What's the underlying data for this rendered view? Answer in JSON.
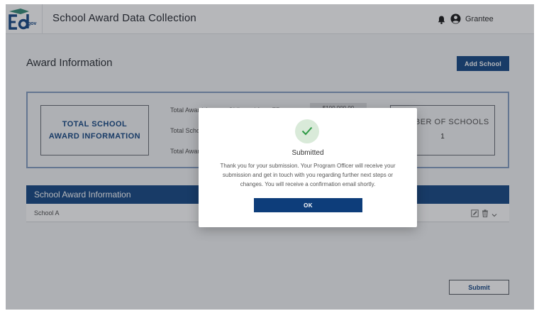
{
  "header": {
    "logo_text": ".gov",
    "title": "School Award Data Collection",
    "user_label": "Grantee",
    "icons": {
      "notifications": "bell-icon",
      "account": "user-circle-icon"
    }
  },
  "page": {
    "heading": "Award Information",
    "add_school_label": "Add School",
    "submit_label": "Submit"
  },
  "summary": {
    "total_lines": [
      "TOTAL SCHOOL",
      "AWARD INFORMATION"
    ],
    "rows": [
      {
        "label": "Total Award Amount Obligated from FR"
      },
      {
        "label": "Total School Award Amount"
      },
      {
        "label": "Total Award Amount Remaining"
      }
    ],
    "first_value": "$100,000.00",
    "count_label": "NUMBER OF SCHOOLS",
    "count_value": "1"
  },
  "table": {
    "title": "School Award Information",
    "rows": [
      {
        "name": "School A"
      }
    ],
    "row_icons": [
      "edit-icon",
      "trash-icon",
      "chevron-down-icon"
    ]
  },
  "modal": {
    "icon": "check-icon",
    "title": "Submitted",
    "body": "Thank you for your submission. Your Program Officer will receive your submission and get in touch with you regarding further next steps or changes. You will receive a confirmation email shortly.",
    "ok_label": "OK"
  },
  "colors": {
    "primary": "#1d4e89",
    "modal_button": "#0d3d7a",
    "success_bg": "#d9ead9",
    "success": "#2e9a46",
    "summary_border": "#8aa2c4"
  }
}
